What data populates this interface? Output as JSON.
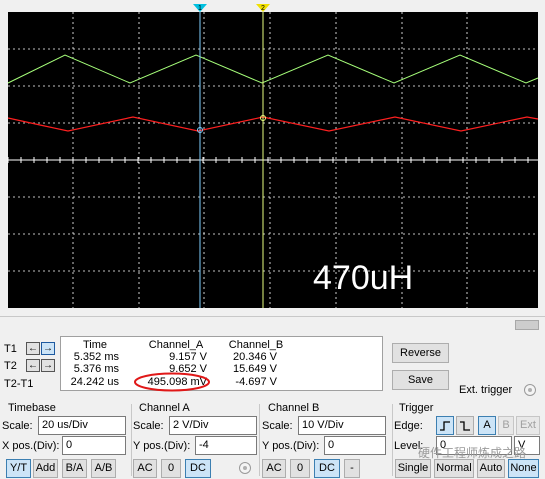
{
  "scope": {
    "annotation": "470uH",
    "colors": {
      "background": "#000000",
      "grid": "#ffffff",
      "channel_a": "#ff2020",
      "channel_b": "#a6ff7a",
      "cursor1": "#7fd0ff",
      "cursor2": "#e8ff80",
      "cursor1_marker": "#00c0e0",
      "cursor2_marker": "#f0e000"
    },
    "cursor_labels": {
      "t1_marker": "1",
      "t2_marker": "2"
    }
  },
  "cursors": {
    "t1_label": "T1",
    "t2_label": "T2",
    "t2_t1_label": "T2-T1"
  },
  "readout": {
    "headers": {
      "time": "Time",
      "channel_a": "Channel_A",
      "channel_b": "Channel_B"
    },
    "rows": [
      {
        "time": "5.352 ms",
        "channel_a": "9.157 V",
        "channel_b": "20.346 V"
      },
      {
        "time": "5.376 ms",
        "channel_a": "9.652 V",
        "channel_b": "15.649 V"
      },
      {
        "time": "24.242 us",
        "channel_a": "495.098 mV",
        "channel_b": "-4.697 V"
      }
    ]
  },
  "actions": {
    "reverse": "Reverse",
    "save": "Save",
    "ext_trigger": "Ext. trigger"
  },
  "timebase": {
    "title": "Timebase",
    "scale_label": "Scale:",
    "scale_value": "20 us/Div",
    "xpos_label": "X pos.(Div):",
    "xpos_value": "0",
    "modes": [
      "Y/T",
      "Add",
      "B/A",
      "A/B"
    ],
    "selected_mode": "Y/T"
  },
  "channel_a": {
    "title": "Channel A",
    "scale_label": "Scale:",
    "scale_value": "2  V/Div",
    "ypos_label": "Y pos.(Div):",
    "ypos_value": "-4",
    "coupling": [
      "AC",
      "0",
      "DC"
    ],
    "selected_coupling": "DC"
  },
  "channel_b": {
    "title": "Channel B",
    "scale_label": "Scale:",
    "scale_value": "10  V/Div",
    "ypos_label": "Y pos.(Div):",
    "ypos_value": "0",
    "coupling": [
      "AC",
      "0",
      "DC",
      "-"
    ],
    "selected_coupling": "DC"
  },
  "trigger": {
    "title": "Trigger",
    "edge_label": "Edge:",
    "level_label": "Level:",
    "level_value": "0",
    "level_unit": "V",
    "sources": [
      "A",
      "B",
      "Ext"
    ],
    "selected_source": "A",
    "modes": [
      "Single",
      "Normal",
      "Auto",
      "None"
    ],
    "selected_mode": "None"
  },
  "watermark": "硬件工程师炼成之路"
}
